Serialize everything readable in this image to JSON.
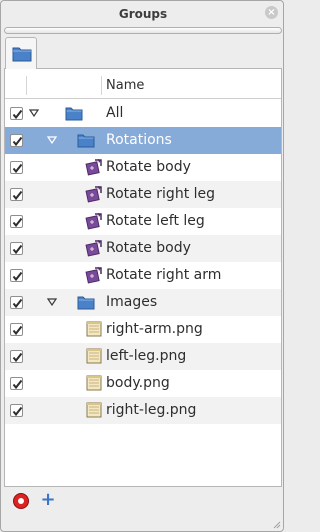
{
  "window": {
    "title": "Groups"
  },
  "icons": {
    "close": "close-icon",
    "folder": "folder-icon",
    "transform": "transform-icon",
    "image": "image-icon",
    "remove": "remove-icon",
    "add": "add-icon"
  },
  "table": {
    "column_name": "Name"
  },
  "tree": [
    {
      "label": "All",
      "checked": true,
      "depth": 0,
      "kind": "folder",
      "expanded": true,
      "selected": false
    },
    {
      "label": "Rotations",
      "checked": true,
      "depth": 1,
      "kind": "folder",
      "expanded": true,
      "selected": true
    },
    {
      "label": "Rotate body",
      "checked": true,
      "depth": 2,
      "kind": "transform",
      "selected": false
    },
    {
      "label": "Rotate right leg",
      "checked": true,
      "depth": 2,
      "kind": "transform",
      "selected": false
    },
    {
      "label": "Rotate left leg",
      "checked": true,
      "depth": 2,
      "kind": "transform",
      "selected": false
    },
    {
      "label": "Rotate body",
      "checked": true,
      "depth": 2,
      "kind": "transform",
      "selected": false
    },
    {
      "label": "Rotate right arm",
      "checked": true,
      "depth": 2,
      "kind": "transform",
      "selected": false
    },
    {
      "label": "Images",
      "checked": true,
      "depth": 1,
      "kind": "folder",
      "expanded": true,
      "selected": false
    },
    {
      "label": "right-arm.png",
      "checked": true,
      "depth": 2,
      "kind": "image",
      "selected": false
    },
    {
      "label": "left-leg.png",
      "checked": true,
      "depth": 2,
      "kind": "image",
      "selected": false
    },
    {
      "label": "body.png",
      "checked": true,
      "depth": 2,
      "kind": "image",
      "selected": false
    },
    {
      "label": "right-leg.png",
      "checked": true,
      "depth": 2,
      "kind": "image",
      "selected": false
    }
  ],
  "colors": {
    "selection": "#86abd9",
    "folder": "#4a82c9",
    "transform": "#7a4a9a",
    "remove": "#dd2222",
    "add": "#3b74c8"
  }
}
